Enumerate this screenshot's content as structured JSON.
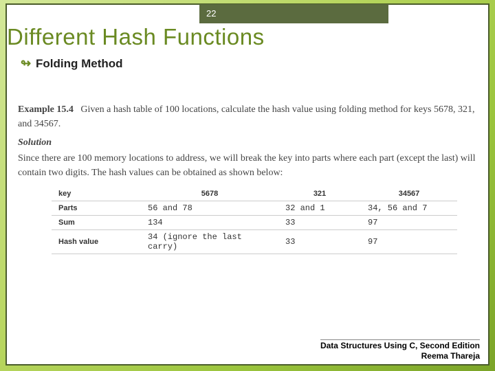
{
  "page_number": "22",
  "title": "Different Hash Functions",
  "bullet": "Folding Method",
  "example": {
    "label": "Example 15.4",
    "text": "Given a hash table of 100 locations, calculate the hash value using folding method for keys 5678, 321, and 34567.",
    "solution_label": "Solution",
    "solution_text": "Since there are 100 memory locations to address, we will break the key into parts where each part (except the last) will contain two digits. The hash values can be obtained as shown below:"
  },
  "chart_data": {
    "type": "table",
    "headers": [
      "key",
      "5678",
      "321",
      "34567"
    ],
    "rows": [
      {
        "label": "Parts",
        "c1": "56 and 78",
        "c2": "32 and 1",
        "c3": "34, 56 and 7"
      },
      {
        "label": "Sum",
        "c1": "134",
        "c2": "33",
        "c3": "97"
      },
      {
        "label": "Hash value",
        "c1": "34 (ignore the last carry)",
        "c2": "33",
        "c3": "97"
      }
    ]
  },
  "footer": {
    "line1": "Data Structures Using C, Second Edition",
    "line2": "Reema Thareja"
  }
}
